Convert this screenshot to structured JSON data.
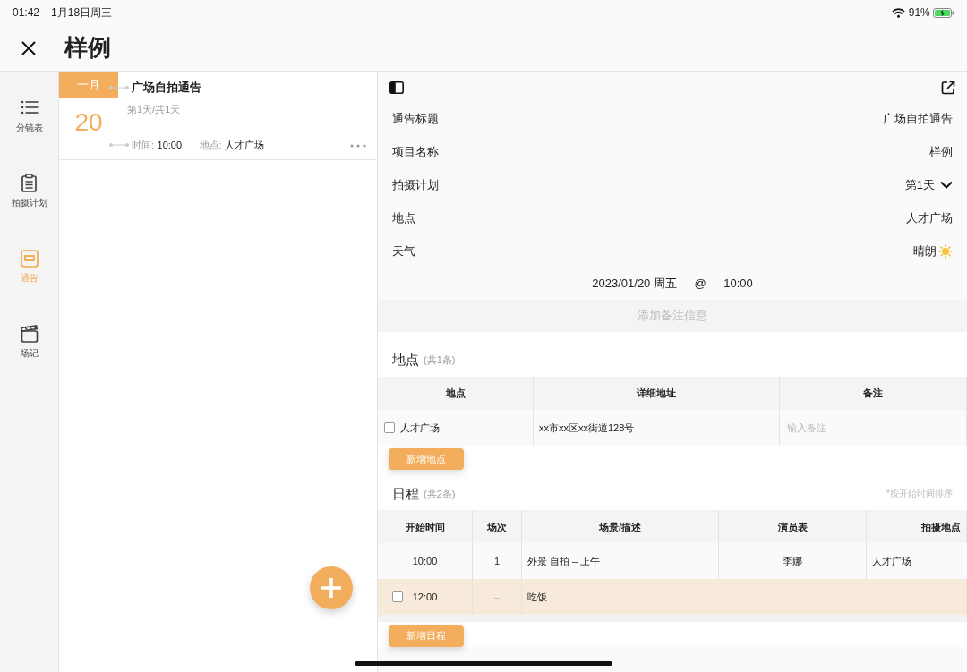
{
  "status_bar": {
    "time": "01:42",
    "date": "1月18日周三",
    "battery": "91%",
    "charging": true
  },
  "header": {
    "title": "样例"
  },
  "sidebar": {
    "items": [
      {
        "label": "分镜表",
        "selected": false
      },
      {
        "label": "拍摄计划",
        "selected": false
      },
      {
        "label": "通告",
        "selected": true
      },
      {
        "label": "场记",
        "selected": false
      }
    ]
  },
  "notices": [
    {
      "month": "一月",
      "day": "20",
      "title": "广场自拍通告",
      "progress": "第1天/共1天",
      "time_label": "时间:",
      "time": "10:00",
      "place_label": "地点:",
      "place": "人才广场"
    }
  ],
  "detail": {
    "fields": [
      {
        "kind": "text",
        "label": "通告标题",
        "value": "广场自拍通告"
      },
      {
        "kind": "text",
        "label": "项目名称",
        "value": "样例"
      },
      {
        "kind": "dropdown",
        "label": "拍摄计划",
        "value": "第1天"
      },
      {
        "kind": "text",
        "label": "地点",
        "value": "人才广场"
      },
      {
        "kind": "weather",
        "label": "天气",
        "value": "晴朗"
      }
    ],
    "datetime": {
      "date": "2023/01/20 周五",
      "at": "@",
      "time": "10:00"
    },
    "note_button": "添加备注信息"
  },
  "locations": {
    "title": "地点",
    "count": "(共1条)",
    "columns": [
      "地点",
      "详细地址",
      "备注"
    ],
    "rows": [
      {
        "name": "人才广场",
        "address": "xx市xx区xx街道128号",
        "note_placeholder": "输入备注",
        "checked": false
      }
    ],
    "add_button": "新增地点"
  },
  "schedule": {
    "title": "日程",
    "count": "(共2条)",
    "hint": "*按开始时间排序",
    "columns": [
      "开始时间",
      "场次",
      "场景/描述",
      "演员表",
      "拍摄地点"
    ],
    "rows": [
      {
        "kind": "scene",
        "start": "10:00",
        "scene": "1",
        "description": "外景 自拍 – 上午",
        "cast": "李娜",
        "location": "人才广场"
      },
      {
        "kind": "break",
        "start": "12:00",
        "scene": "–",
        "description": "吃饭",
        "checked": false
      }
    ],
    "add_button": "新增日程"
  }
}
